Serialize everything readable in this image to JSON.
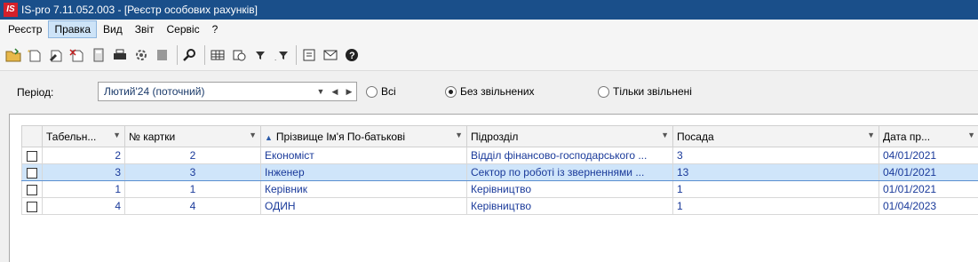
{
  "window": {
    "logo_text": "IS",
    "title": "IS-pro 7.11.052.003 - [Реєстр особових рахунків]"
  },
  "menu": {
    "items": [
      "Реєстр",
      "Правка",
      "Вид",
      "Звіт",
      "Сервіс",
      "?"
    ],
    "active_index": 1
  },
  "toolbar": {
    "icons": [
      "open-folder-icon",
      "new-record-icon",
      "edit-record-icon",
      "delete-record-icon",
      "calculator-icon",
      "print-icon",
      "settings-gear-icon",
      "archive-icon",
      "search-icon",
      "table-icon",
      "refresh-icon",
      "filter-icon",
      "filter-clear-icon",
      "form-icon",
      "mail-icon",
      "help-icon"
    ]
  },
  "filter": {
    "period_label": "Період:",
    "period_value": "Лютий'24 (поточний)",
    "radios": [
      {
        "label": "Всі",
        "checked": false
      },
      {
        "label": "Без звільнених",
        "checked": true
      },
      {
        "label": "Тільки звільнені",
        "checked": false
      }
    ]
  },
  "table": {
    "columns": [
      "Табельн...",
      "№ картки",
      "Прізвище Ім'я По-батькові",
      "Підрозділ",
      "Посада",
      "Дата пр..."
    ],
    "rows": [
      {
        "tab": "2",
        "card": "2",
        "name": "Економіст",
        "dept": "Відділ фінансово-господарського ...",
        "pos": "3",
        "date": "04/01/2021",
        "selected": false
      },
      {
        "tab": "3",
        "card": "3",
        "name": "Інженер",
        "dept": "Сектор по роботі із зверненнями ...",
        "pos": "13",
        "date": "04/01/2021",
        "selected": true
      },
      {
        "tab": "1",
        "card": "1",
        "name": "Керівник",
        "dept": "Керівництво",
        "pos": "1",
        "date": "01/01/2021",
        "selected": false
      },
      {
        "tab": "4",
        "card": "4",
        "name": "ОДИН",
        "dept": "Керівництво",
        "pos": "1",
        "date": "01/04/2023",
        "selected": false
      }
    ]
  },
  "colors": {
    "titlebar": "#1a4f8a",
    "accent_text": "#1a3a9a",
    "selection": "#cfe5fa"
  }
}
